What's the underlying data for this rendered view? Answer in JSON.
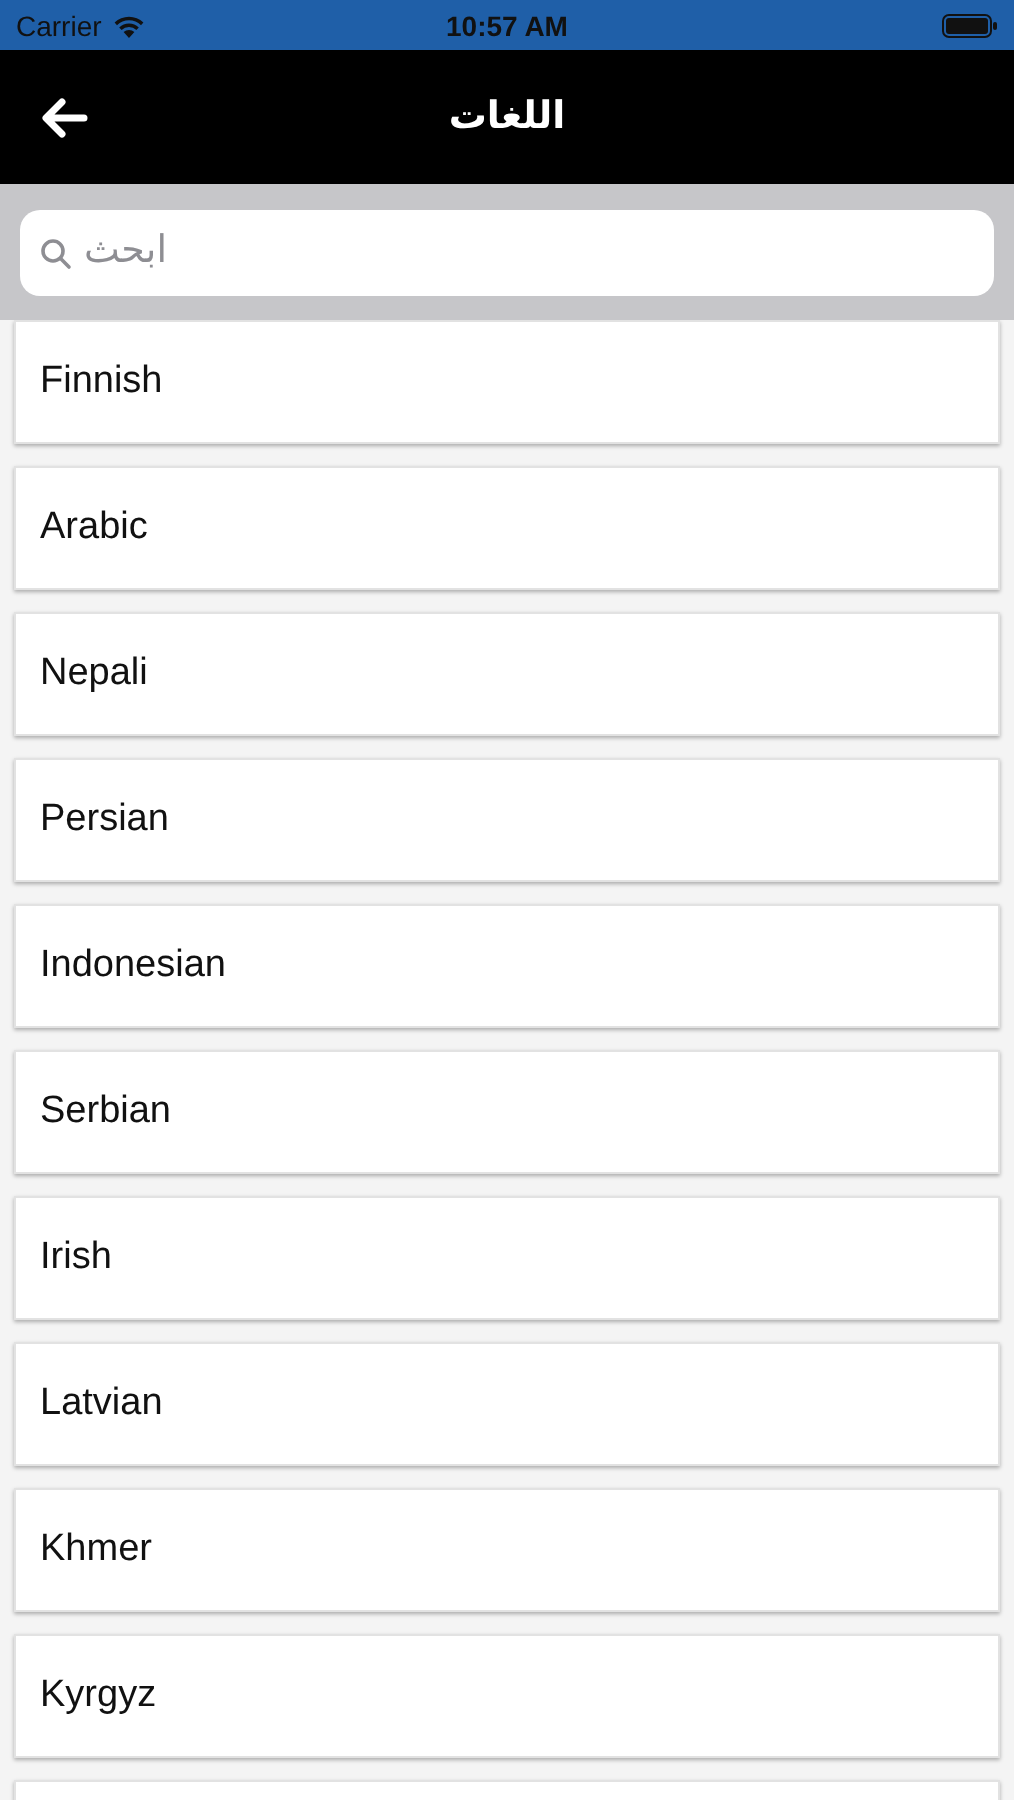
{
  "status_bar": {
    "carrier": "Carrier",
    "time": "10:57 AM"
  },
  "nav_bar": {
    "title": "اللغات"
  },
  "search": {
    "placeholder": "ابحث"
  },
  "languages": [
    {
      "name": "Finnish"
    },
    {
      "name": "Arabic"
    },
    {
      "name": "Nepali"
    },
    {
      "name": "Persian"
    },
    {
      "name": "Indonesian"
    },
    {
      "name": "Serbian"
    },
    {
      "name": "Irish"
    },
    {
      "name": "Latvian"
    },
    {
      "name": "Khmer"
    },
    {
      "name": "Kyrgyz"
    }
  ]
}
